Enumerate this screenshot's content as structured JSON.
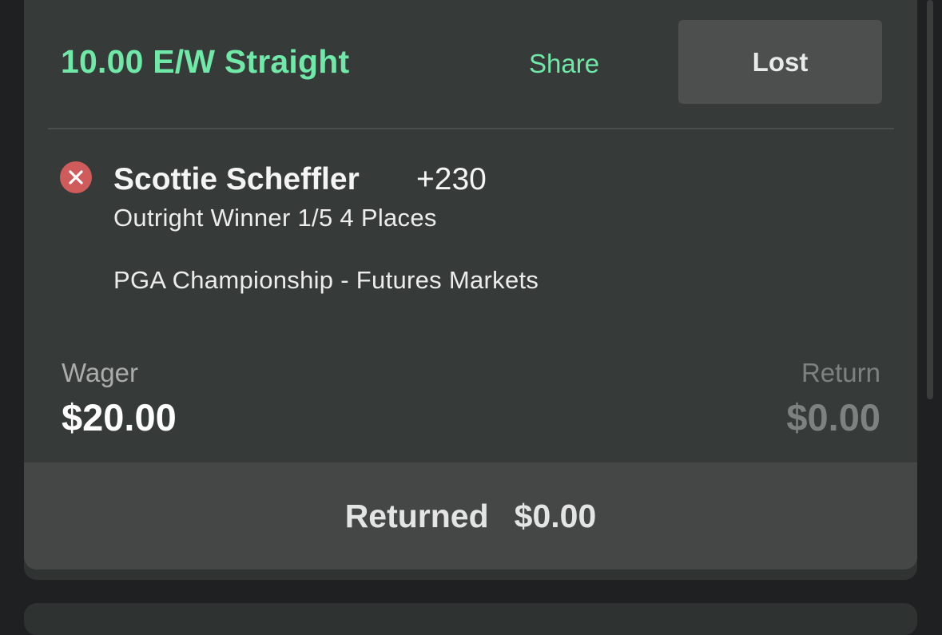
{
  "bet": {
    "title": "10.00 E/W Straight",
    "share_label": "Share",
    "status_label": "Lost"
  },
  "selection": {
    "status_icon": "x-circle-icon",
    "name": "Scottie Scheffler",
    "odds": "+230",
    "market": "Outright Winner 1/5 4 Places",
    "event": "PGA Championship - Futures Markets"
  },
  "wager": {
    "label": "Wager",
    "value": "$20.00"
  },
  "return": {
    "label": "Return",
    "value": "$0.00"
  },
  "footer": {
    "label": "Returned",
    "value": "$0.00"
  },
  "colors": {
    "accent_green": "#6fe8a8",
    "lost_red": "#d05b5b",
    "card_bg": "#363b3a",
    "footer_bg": "#444746"
  }
}
